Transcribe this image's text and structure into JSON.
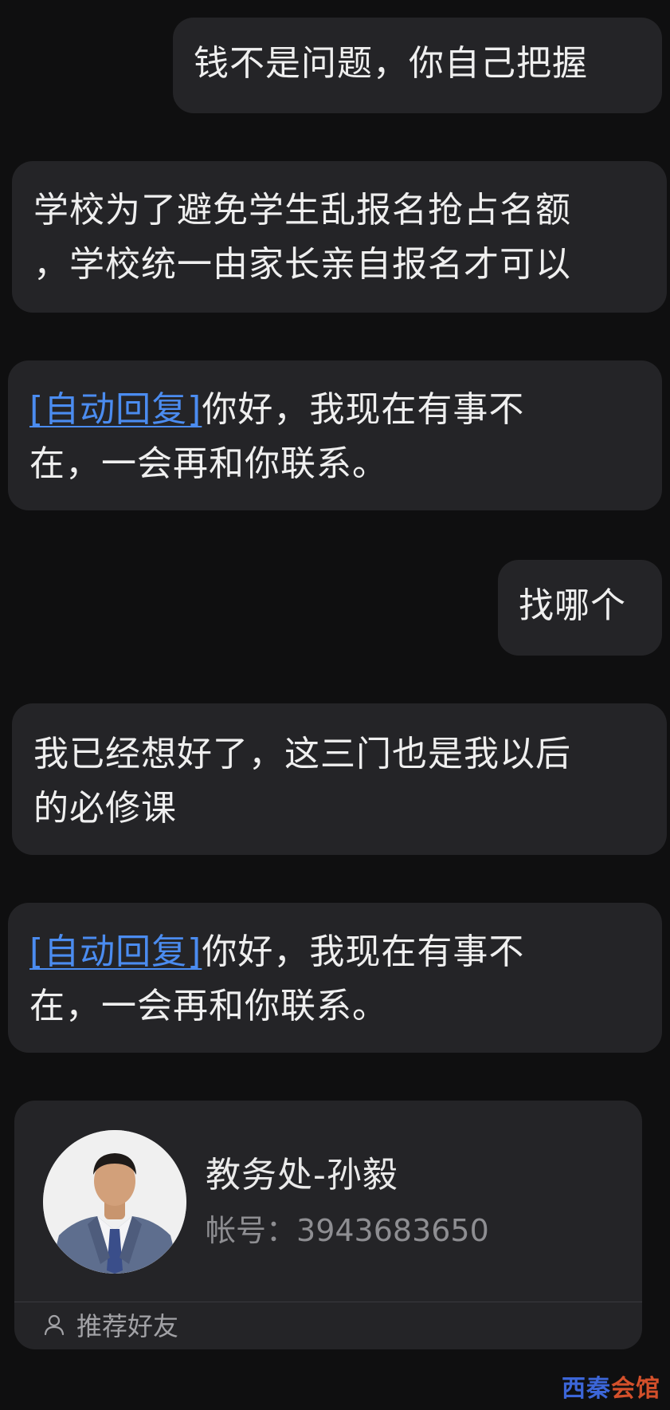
{
  "messages": [
    {
      "id": "b1",
      "side": "right",
      "lines": [
        "钱不是问题，你自己把握"
      ]
    },
    {
      "id": "b2",
      "side": "left",
      "lines": [
        "学校为了避免学生乱报名抢占名额",
        "，学校统一由家长亲自报名才可以"
      ]
    },
    {
      "id": "b3",
      "side": "left",
      "auto_tag": "[自动回复]",
      "lines": [
        "你好，我现在有事不",
        "在，一会再和你联系。"
      ]
    },
    {
      "id": "b4",
      "side": "right",
      "lines": [
        "找哪个"
      ]
    },
    {
      "id": "b5",
      "side": "left",
      "lines": [
        "我已经想好了，这三门也是我以后",
        "的必修课"
      ]
    },
    {
      "id": "b6",
      "side": "left",
      "auto_tag": "[自动回复]",
      "lines": [
        "你好，我现在有事不",
        "在，一会再和你联系。"
      ]
    }
  ],
  "contact_card": {
    "name": "教务处-孙毅",
    "account_label": "帐号：",
    "account_number": "3943683650",
    "footer_label": "推荐好友",
    "footer_icon": "user-icon"
  },
  "watermark": {
    "part1": "西秦",
    "part2": "会馆"
  },
  "colors": {
    "background": "#0f0f10",
    "bubble": "#242427",
    "link": "#4b8cf0"
  }
}
